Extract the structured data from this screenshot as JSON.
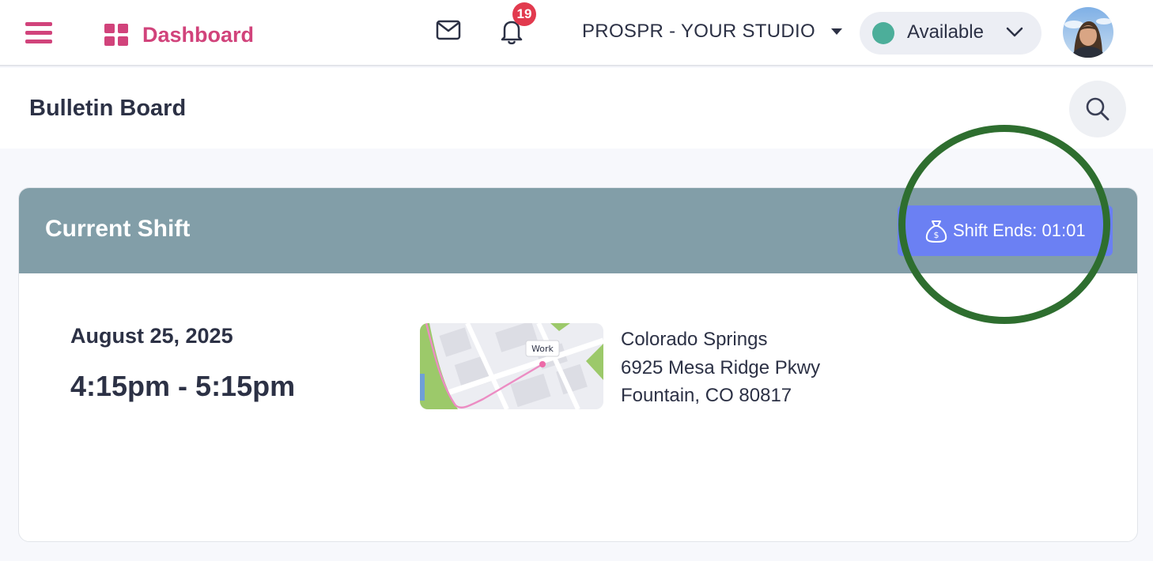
{
  "topbar": {
    "brand": {
      "label": "Dashboard",
      "icon": "dashboard-grid-icon"
    },
    "notifications_count": "19",
    "studio": {
      "label": "PROSPR - YOUR STUDIO"
    },
    "status": {
      "label": "Available",
      "dot_color": "#4cae9a"
    }
  },
  "subheader": {
    "title": "Bulletin Board"
  },
  "current_shift": {
    "title": "Current Shift",
    "ends_label": "Shift Ends: 01:01",
    "date": "August 25, 2025",
    "time": "4:15pm - 5:15pm",
    "map_pin_label": "Work",
    "address": {
      "line1": "Colorado Springs",
      "line2": "6925 Mesa Ridge Pkwy",
      "line3": "Fountain, CO 80817"
    }
  },
  "colors": {
    "brand": "#d1437b",
    "card_header": "#829ea8",
    "shift_button": "#6b80f3",
    "badge": "#e23a4e",
    "annotation": "#2e6e2f"
  }
}
